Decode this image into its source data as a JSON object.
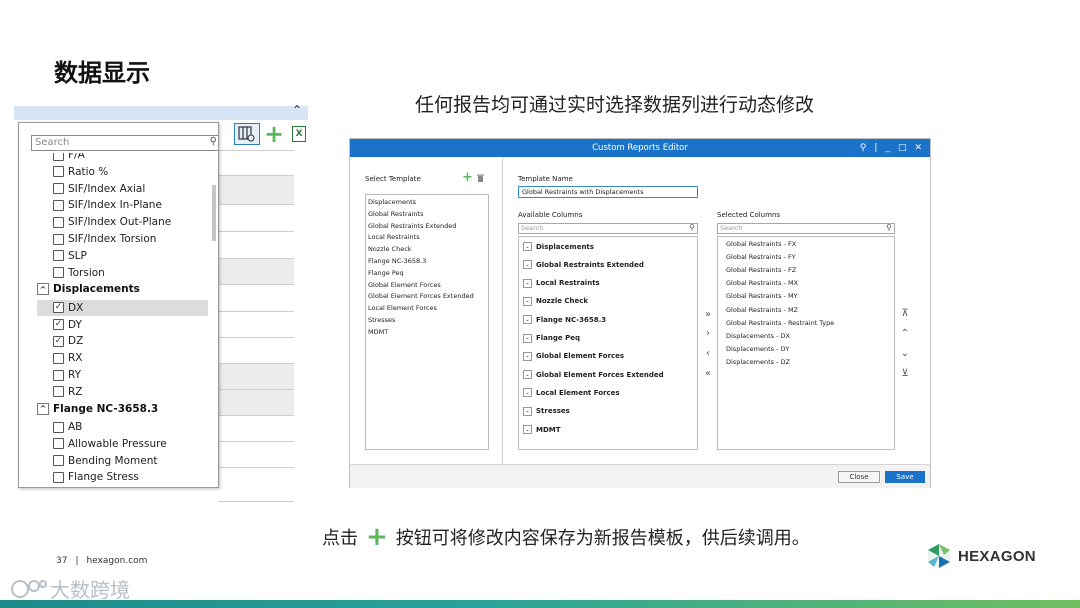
{
  "slide": {
    "title": "数据显示",
    "subtitle": "任何报告均可通过实时选择数据列进行动态修改",
    "note_before": "点击",
    "note_after": "按钮可将修改内容保存为新报告模板，供后续调用。",
    "page_number": "37",
    "page_site": "hexagon.com",
    "logo_text": "HEXAGON",
    "watermark_text": "大数跨境"
  },
  "column_picker": {
    "search_placeholder": "Search",
    "items": [
      {
        "label": "F/A",
        "kind": "item",
        "checked": false
      },
      {
        "label": "Ratio %",
        "kind": "item",
        "checked": false
      },
      {
        "label": "SIF/Index Axial",
        "kind": "item",
        "checked": false
      },
      {
        "label": "SIF/Index In-Plane",
        "kind": "item",
        "checked": false
      },
      {
        "label": "SIF/Index Out-Plane",
        "kind": "item",
        "checked": false
      },
      {
        "label": "SIF/Index Torsion",
        "kind": "item",
        "checked": false
      },
      {
        "label": "SLP",
        "kind": "item",
        "checked": false
      },
      {
        "label": "Torsion",
        "kind": "item",
        "checked": false
      },
      {
        "label": "Displacements",
        "kind": "group",
        "expanded": true
      },
      {
        "label": "DX",
        "kind": "item",
        "checked": true,
        "selected": true
      },
      {
        "label": "DY",
        "kind": "item",
        "checked": true
      },
      {
        "label": "DZ",
        "kind": "item",
        "checked": true
      },
      {
        "label": "RX",
        "kind": "item",
        "checked": false
      },
      {
        "label": "RY",
        "kind": "item",
        "checked": false
      },
      {
        "label": "RZ",
        "kind": "item",
        "checked": false
      },
      {
        "label": "Flange NC-3658.3",
        "kind": "group",
        "expanded": true
      },
      {
        "label": "AB",
        "kind": "item",
        "checked": false
      },
      {
        "label": "Allowable Pressure",
        "kind": "item",
        "checked": false
      },
      {
        "label": "Bending Moment",
        "kind": "item",
        "checked": false
      },
      {
        "label": "Flange Stress",
        "kind": "item",
        "checked": false
      }
    ]
  },
  "editor": {
    "title": "Custom Reports Editor",
    "select_template_label": "Select Template",
    "templates": [
      "Displacements",
      "Global Restraints",
      "Global Restraints Extended",
      "Local Restraints",
      "Nozzle Check",
      "Flange NC-3658.3",
      "Flange Peq",
      "Global Element Forces",
      "Global Element Forces Extended",
      "Local Element Forces",
      "Stresses",
      "MDMT"
    ],
    "template_name_label": "Template Name",
    "template_name_value": "Global Restraints with Displacements",
    "available_columns_label": "Available Columns",
    "selected_columns_label": "Selected Columns",
    "search_placeholder": "Search",
    "available_groups": [
      "Displacements",
      "Global Restraints Extended",
      "Local Restraints",
      "Nozzle Check",
      "Flange NC-3658.3",
      "Flange Peq",
      "Global Element Forces",
      "Global Element Forces Extended",
      "Local Element Forces",
      "Stresses",
      "MDMT"
    ],
    "selected_columns": [
      "Global Restraints - FX",
      "Global Restraints - FY",
      "Global Restraints - FZ",
      "Global Restraints - MX",
      "Global Restraints - MY",
      "Global Restraints - MZ",
      "Global Restraints - Restraint Type",
      "Displacements - DX",
      "Displacements - DY",
      "Displacements - DZ"
    ],
    "close_label": "Close",
    "save_label": "Save"
  },
  "colors": {
    "accent_blue": "#1a73c9",
    "plus_green": "#5cb85c"
  }
}
